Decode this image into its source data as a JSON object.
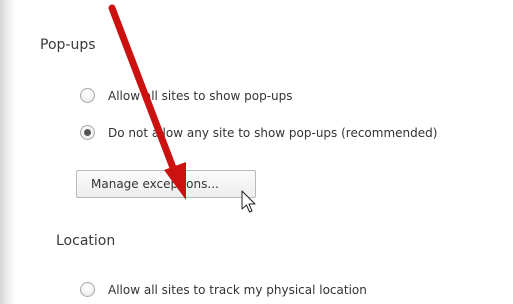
{
  "popups": {
    "heading": "Pop-ups",
    "options": [
      {
        "label": "Allow all sites to show pop-ups",
        "checked": false
      },
      {
        "label": "Do not allow any site to show pop-ups (recommended)",
        "checked": true
      }
    ],
    "manage_button_label": "Manage exceptions..."
  },
  "location": {
    "heading": "Location",
    "options": [
      {
        "label": "Allow all sites to track my physical location",
        "checked": false
      }
    ]
  },
  "annotation": {
    "arrow_color": "#cc1111"
  }
}
